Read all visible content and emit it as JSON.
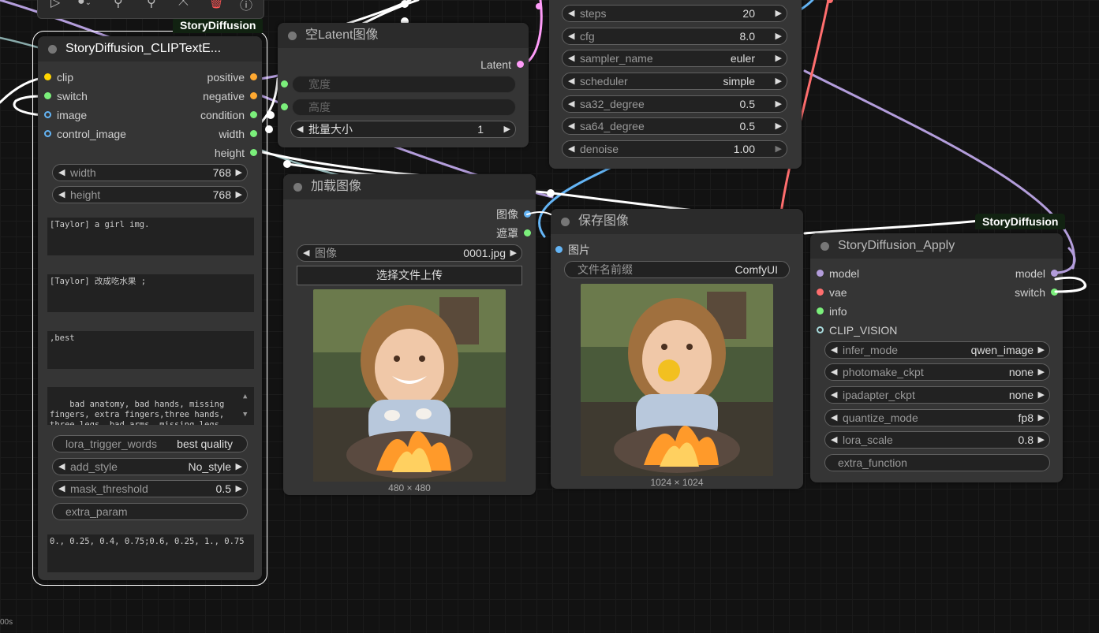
{
  "toolbar": {
    "items": [
      "play-icon",
      "color-icon",
      "wand-icon",
      "pin-icon",
      "collapse-icon",
      "trash-icon",
      "help-icon"
    ]
  },
  "status": {
    "text": "00s"
  },
  "nodes": {
    "clip_text": {
      "badge": "StoryDiffusion",
      "title": "StoryDiffusion_CLIPTextE...",
      "inputs": [
        "clip",
        "switch",
        "image",
        "control_image"
      ],
      "outputs": [
        "positive",
        "negative",
        "condition",
        "width",
        "height"
      ],
      "width": {
        "label": "width",
        "value": "768"
      },
      "height": {
        "label": "height",
        "value": "768"
      },
      "text1": "[Taylor] a girl img.",
      "text2": "[Taylor] 改成吃水果 ;",
      "text3": ",best",
      "text4": "bad anatomy, bad hands, missing fingers, extra fingers,three hands, three legs, bad arms, missing legs, missing arms, poorly drawn face, bad",
      "lora_trigger_words": {
        "label": "lora_trigger_words",
        "value": "best quality"
      },
      "add_style": {
        "label": "add_style",
        "value": "No_style"
      },
      "mask_threshold": {
        "label": "mask_threshold",
        "value": "0.5"
      },
      "extra_param": {
        "label": "extra_param"
      },
      "text5": "0., 0.25, 0.4, 0.75;0.6, 0.25, 1., 0.75"
    },
    "latent": {
      "title": "空Latent图像",
      "output": "Latent",
      "width": {
        "label": "宽度"
      },
      "height": {
        "label": "高度"
      },
      "batch": {
        "label": "批量大小",
        "value": "1"
      }
    },
    "sampler": {
      "steps": {
        "label": "steps",
        "value": "20"
      },
      "cfg": {
        "label": "cfg",
        "value": "8.0"
      },
      "sampler_name": {
        "label": "sampler_name",
        "value": "euler"
      },
      "scheduler": {
        "label": "scheduler",
        "value": "simple"
      },
      "sa32": {
        "label": "sa32_degree",
        "value": "0.5"
      },
      "sa64": {
        "label": "sa64_degree",
        "value": "0.5"
      },
      "denoise": {
        "label": "denoise",
        "value": "1.00"
      }
    },
    "load_image": {
      "title": "加载图像",
      "outputs": [
        "图像",
        "遮罩"
      ],
      "image": {
        "label": "图像",
        "value": "0001.jpg"
      },
      "upload": "选择文件上传",
      "size": "480 × 480"
    },
    "save_image": {
      "title": "保存图像",
      "input": "图片",
      "prefix": {
        "label": "文件名前缀",
        "value": "ComfyUI"
      },
      "size": "1024 × 1024"
    },
    "apply": {
      "badge": "StoryDiffusion",
      "title": "StoryDiffusion_Apply",
      "inputs": [
        "model",
        "vae",
        "info",
        "CLIP_VISION"
      ],
      "outputs": [
        "model",
        "switch"
      ],
      "infer_mode": {
        "label": "infer_mode",
        "value": "qwen_image"
      },
      "photomake_ckpt": {
        "label": "photomake_ckpt",
        "value": "none"
      },
      "ipadapter_ckpt": {
        "label": "ipadapter_ckpt",
        "value": "none"
      },
      "quantize_mode": {
        "label": "quantize_mode",
        "value": "fp8"
      },
      "lora_scale": {
        "label": "lora_scale",
        "value": "0.8"
      },
      "extra_function": {
        "label": "extra_function"
      }
    }
  },
  "colors": {
    "clip": "#ffd500",
    "switch": "#7bef7b",
    "image": "#64b5f6",
    "conditioning": "#ffa931",
    "int": "#7bef7b",
    "latent": "#ff9cf9",
    "model": "#b39ddb",
    "vae": "#ff6e6e",
    "clip_vision": "#a8dadc",
    "wire_white": "#ffffff"
  }
}
